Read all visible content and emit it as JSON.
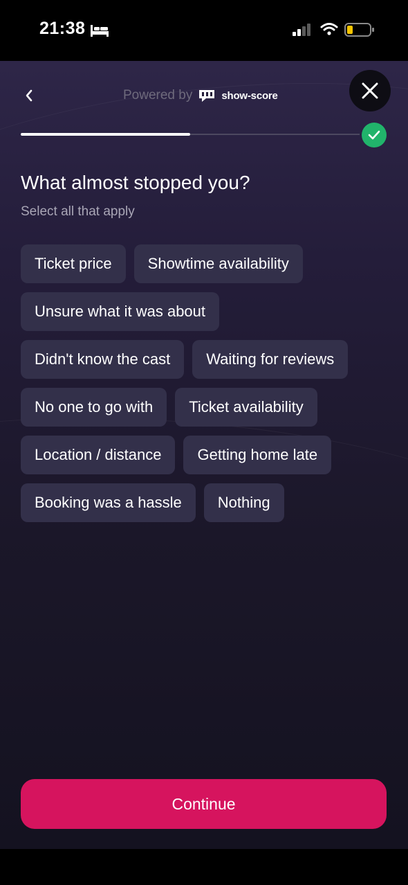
{
  "status_bar": {
    "time": "21:38",
    "icons": [
      "bed-icon",
      "cellular-signal-icon",
      "wifi-icon",
      "battery-icon"
    ]
  },
  "header": {
    "back_icon": "chevron-left-icon",
    "powered_by": "Powered by",
    "brand": "show-score",
    "close_icon": "close-icon"
  },
  "progress": {
    "fraction": 0.5,
    "complete_icon": "check-icon"
  },
  "question": {
    "title": "What almost stopped you?",
    "subtitle": "Select all that apply"
  },
  "options": [
    [
      "Ticket price",
      "Showtime availability"
    ],
    [
      "Unsure what it was about"
    ],
    [
      "Didn't know the cast",
      "Waiting for reviews"
    ],
    [
      "No one to go with",
      "Ticket availability"
    ],
    [
      "Location / distance",
      "Getting home late"
    ],
    [
      "Booking was a hassle",
      "Nothing"
    ]
  ],
  "continue_label": "Continue",
  "colors": {
    "accent": "#d6145e",
    "success": "#21b46b",
    "chip_bg": "#33304a",
    "background": "#241d3a"
  }
}
